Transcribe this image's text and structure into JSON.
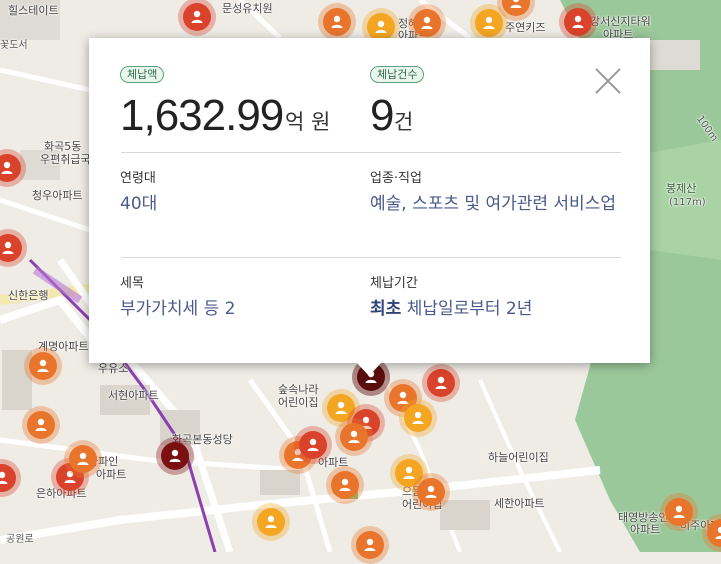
{
  "map": {
    "labels": [
      {
        "t": "힐스테이트"
      },
      {
        "t": "문성유치원"
      },
      {
        "t": "정해텔"
      },
      {
        "t": "아파트"
      },
      {
        "t": "주연키즈"
      },
      {
        "t": "강서신지타워"
      },
      {
        "t": "아파트"
      },
      {
        "t": "화곡5동"
      },
      {
        "t": "우편취급국"
      },
      {
        "t": "청우아파트"
      },
      {
        "t": "신한은행"
      },
      {
        "t": "계명아파트"
      },
      {
        "t": "우유소"
      },
      {
        "t": "서현아파트"
      },
      {
        "t": "숲속나라"
      },
      {
        "t": "어린이집"
      },
      {
        "t": "화곡본동성당"
      },
      {
        "t": "라파인"
      },
      {
        "t": "아파트"
      },
      {
        "t": "은하아파트"
      },
      {
        "t": "아파트"
      },
      {
        "t": "하늘어린이집"
      },
      {
        "t": "으뜸나라"
      },
      {
        "t": "어린이집"
      },
      {
        "t": "세한아파트"
      },
      {
        "t": "태영방송인"
      },
      {
        "t": "아파트"
      },
      {
        "t": "미주아파"
      },
      {
        "t": "봉제산"
      },
      {
        "t": "(117m)"
      },
      {
        "t": "100m"
      },
      {
        "t": "공원로"
      },
      {
        "t": "꽃도서"
      }
    ]
  },
  "popup": {
    "amount_badge": "체납액",
    "amount_value": "1,632.99",
    "amount_unit": "억 원",
    "count_badge": "체납건수",
    "count_value": "9",
    "count_unit": "건",
    "age_label": "연령대",
    "age_value": "40대",
    "job_label": "업종·직업",
    "job_value": "예술, 스포츠 및 여가관련 서비스업",
    "tax_label": "세목",
    "tax_value": "부가가치세 등 2",
    "period_label": "체납기간",
    "period_prefix": "최초",
    "period_value": "체납일로부터 2년"
  },
  "colors": {
    "marker_red": "#d9432b",
    "marker_orange": "#e8762c",
    "marker_yellow": "#f4a622",
    "marker_dark": "#7a1010",
    "badge_green": "#2e6b45",
    "value_blue": "#4a5a8a"
  },
  "icons": {
    "marker": "person-icon",
    "close": "close-icon"
  }
}
